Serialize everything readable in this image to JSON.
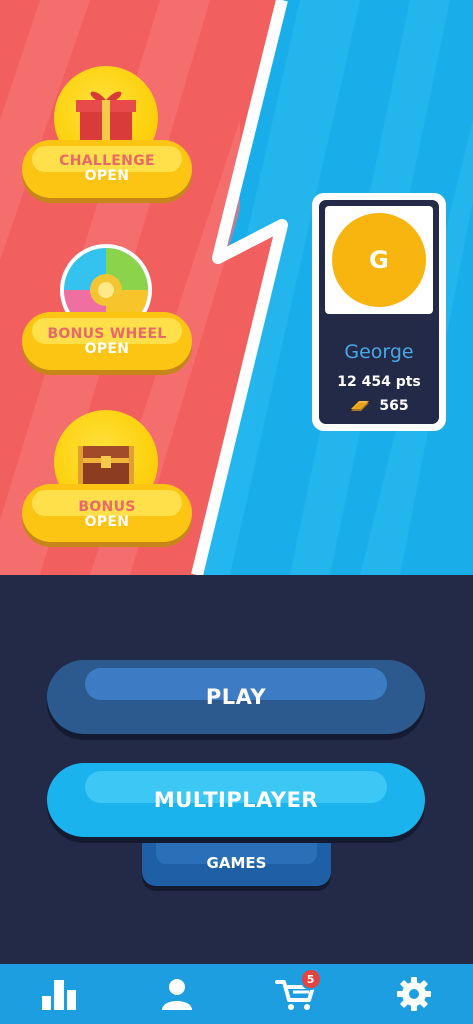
{
  "rewards": [
    {
      "title": "CHALLENGE",
      "status": "OPEN",
      "icon": "gift-icon"
    },
    {
      "title": "BONUS WHEEL",
      "status": "OPEN",
      "icon": "wheel-icon"
    },
    {
      "title": "BONUS",
      "status": "OPEN",
      "icon": "chest-icon"
    }
  ],
  "profile": {
    "initial": "G",
    "name": "George",
    "points": "12 454 pts",
    "coins": "565"
  },
  "buttons": {
    "play": "PLAY",
    "multiplayer": "MULTIPLAYER",
    "games": "GAMES"
  },
  "nav": {
    "cart_badge": "5",
    "items": [
      "leaderboard-icon",
      "profile-icon",
      "cart-icon",
      "settings-icon"
    ]
  },
  "colors": {
    "left_panel": "#f1605f",
    "right_panel": "#19aeea",
    "bottom_bg": "#232a48",
    "nav_bg": "#1c9ee0",
    "gold": "#fcc413"
  }
}
